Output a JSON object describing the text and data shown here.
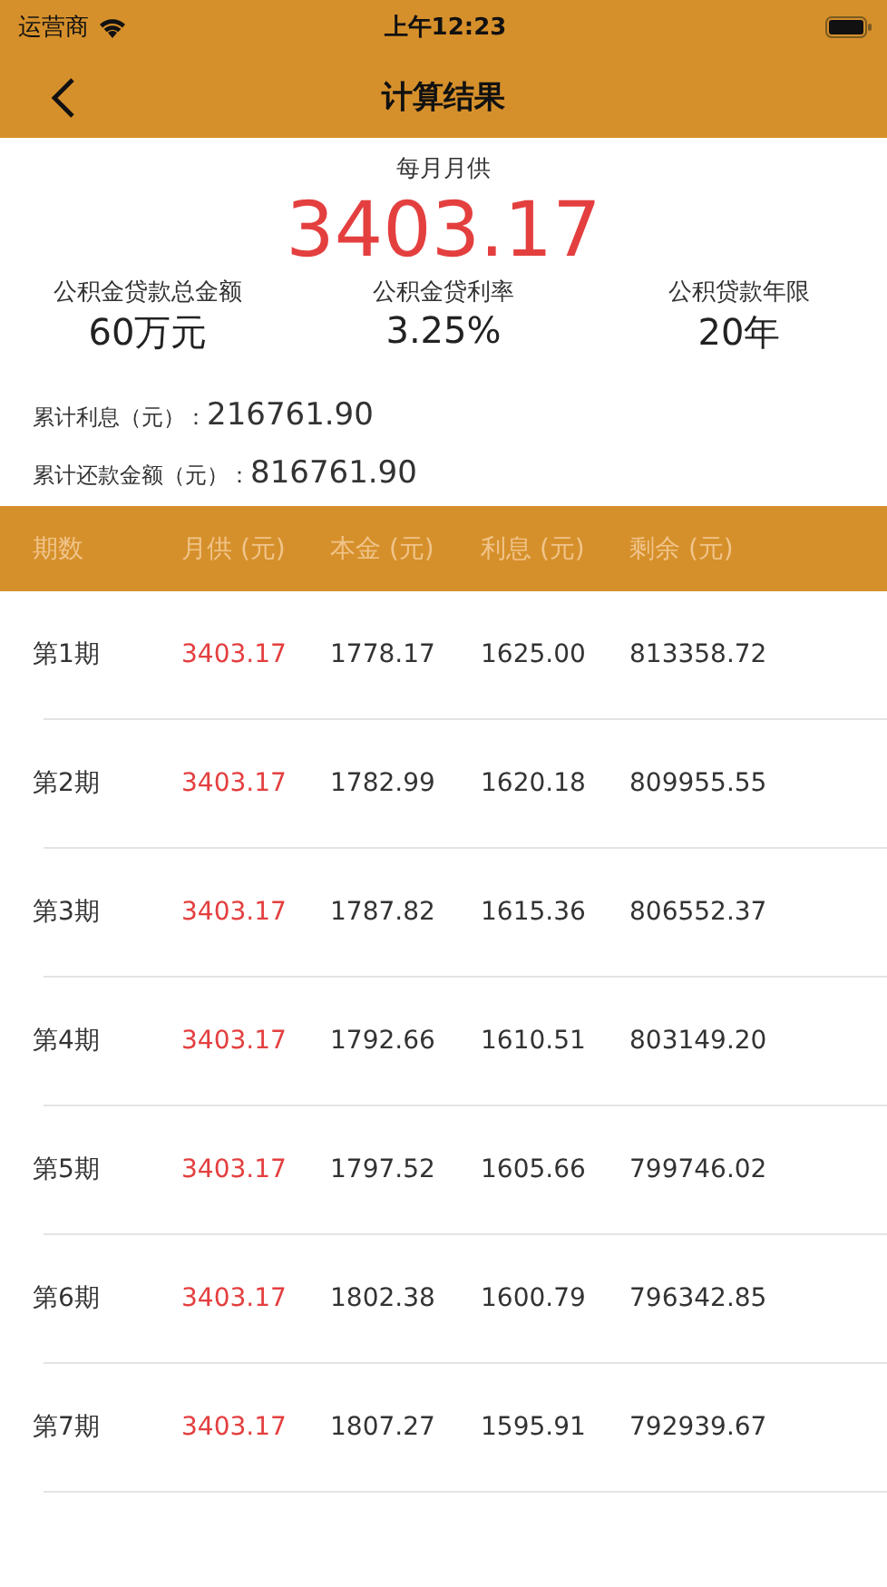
{
  "status_bar": {
    "carrier": "运营商",
    "time": "上午12:23"
  },
  "nav": {
    "title": "计算结果"
  },
  "monthly": {
    "label": "每月月供",
    "value": "3403.17"
  },
  "stats": [
    {
      "label": "公积金贷款总金额",
      "value": "60万元"
    },
    {
      "label": "公积金贷利率",
      "value": "3.25%"
    },
    {
      "label": "公积贷款年限",
      "value": "20年"
    }
  ],
  "totals": [
    {
      "label": "累计利息（元）：",
      "value": "216761.90"
    },
    {
      "label": "累计还款金额（元）：",
      "value": "816761.90"
    }
  ],
  "table": {
    "columns": [
      "期数",
      "月供 (元)",
      "本金 (元)",
      "利息 (元)",
      "剩余 (元)"
    ],
    "rows": [
      [
        "第1期",
        "3403.17",
        "1778.17",
        "1625.00",
        "813358.72"
      ],
      [
        "第2期",
        "3403.17",
        "1782.99",
        "1620.18",
        "809955.55"
      ],
      [
        "第3期",
        "3403.17",
        "1787.82",
        "1615.36",
        "806552.37"
      ],
      [
        "第4期",
        "3403.17",
        "1792.66",
        "1610.51",
        "803149.20"
      ],
      [
        "第5期",
        "3403.17",
        "1797.52",
        "1605.66",
        "799746.02"
      ],
      [
        "第6期",
        "3403.17",
        "1802.38",
        "1600.79",
        "796342.85"
      ],
      [
        "第7期",
        "3403.17",
        "1807.27",
        "1595.91",
        "792939.67"
      ]
    ]
  }
}
